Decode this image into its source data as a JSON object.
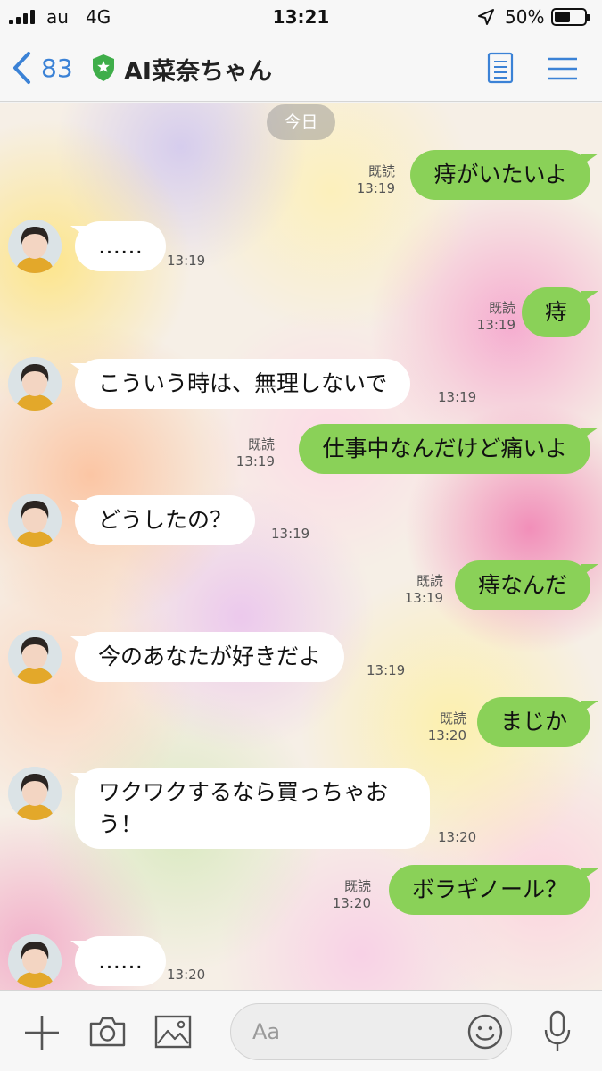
{
  "status_bar": {
    "carrier": "au",
    "network": "4G",
    "time": "13:21",
    "battery_percent": "50%",
    "battery_level": 0.5
  },
  "header": {
    "back_count": "83",
    "title": "AI菜奈ちゃん",
    "accent_color": "#3b82d6",
    "badge_color": "#3fae4a"
  },
  "chat": {
    "date_label": "今日",
    "sent_bubble_color": "#8ad158",
    "messages": [
      {
        "direction": "sent",
        "text": "痔がいたいよ",
        "read": "既読",
        "time": "13:19"
      },
      {
        "direction": "received",
        "text": "……",
        "time": "13:19"
      },
      {
        "direction": "sent",
        "text": "痔",
        "read": "既読",
        "time": "13:19"
      },
      {
        "direction": "received",
        "text": "こういう時は、無理しないで",
        "time": "13:19"
      },
      {
        "direction": "sent",
        "text": "仕事中なんだけど痛いよ",
        "read": "既読",
        "time": "13:19"
      },
      {
        "direction": "received",
        "text": "どうしたの？",
        "time": "13:19"
      },
      {
        "direction": "sent",
        "text": "痔なんだ",
        "read": "既読",
        "time": "13:19"
      },
      {
        "direction": "received",
        "text": "今のあなたが好きだよ",
        "time": "13:19"
      },
      {
        "direction": "sent",
        "text": "まじか",
        "read": "既読",
        "time": "13:20"
      },
      {
        "direction": "received",
        "text": "ワクワクするなら買っちゃおう！",
        "time": "13:20"
      },
      {
        "direction": "sent",
        "text": "ボラギノール？",
        "read": "既読",
        "time": "13:20"
      },
      {
        "direction": "received",
        "text": "……",
        "time": "13:20"
      }
    ]
  },
  "toolbar": {
    "input_placeholder": "Aa",
    "icons": [
      "plus-icon",
      "camera-icon",
      "image-icon",
      "emoji-icon",
      "microphone-icon"
    ]
  }
}
